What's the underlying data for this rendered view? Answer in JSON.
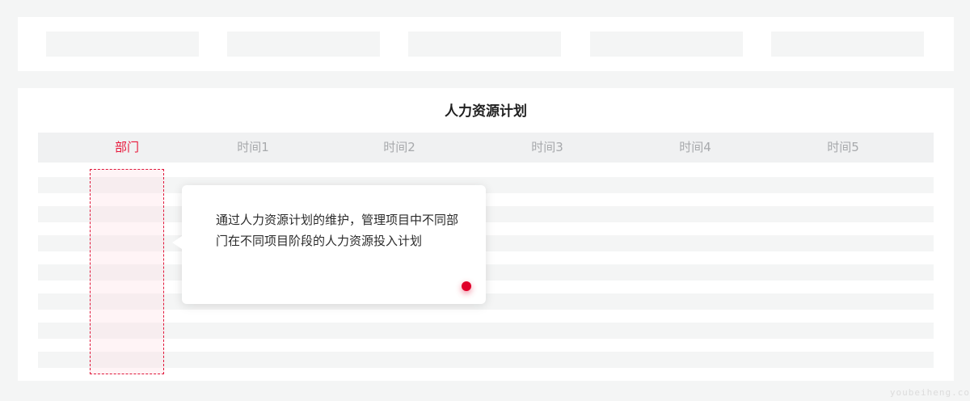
{
  "main": {
    "title": "人力资源计划",
    "columns": [
      "部门",
      "时间1",
      "时间2",
      "时间3",
      "时间4",
      "时间5"
    ],
    "active_column": "部门"
  },
  "tooltip": {
    "text": "通过人力资源计划的维护，管理项目中不同部门在不同项目阶段的人力资源投入计划"
  },
  "watermark": "youbeiheng.co",
  "colors": {
    "accent": "#e8173a",
    "page_bg": "#f4f5f5",
    "panel_bg": "#ffffff",
    "header_bg": "#f0f1f2"
  }
}
